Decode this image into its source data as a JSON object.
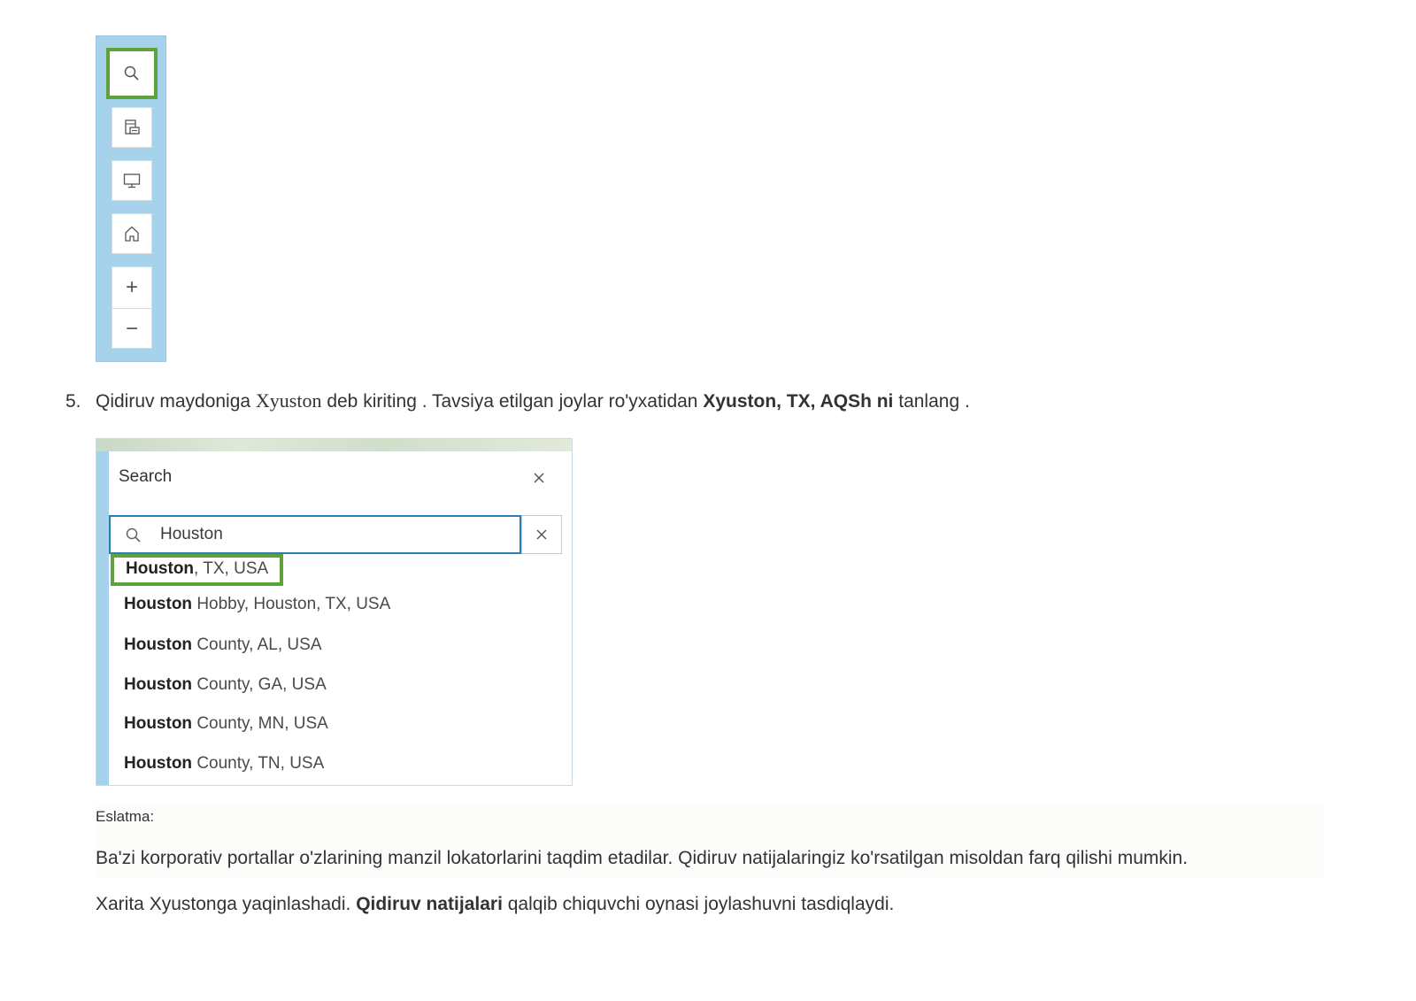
{
  "toolbar": {
    "buttons": [
      {
        "icon": "search-icon"
      },
      {
        "icon": "print-icon"
      },
      {
        "icon": "monitor-icon"
      },
      {
        "icon": "home-icon"
      }
    ],
    "zoom_in": "+",
    "zoom_out": "−"
  },
  "step": {
    "number": "5.",
    "text_before": "Qidiruv maydoniga ",
    "code": "Xyuston",
    "text_middle": " deb kiriting . Tavsiya etilgan joylar ro'yxatidan ",
    "bold": "Xyuston, TX, AQSh ni",
    "text_after": " tanlang ."
  },
  "search_panel": {
    "title": "Search",
    "input_value": "Houston",
    "suggestions": [
      {
        "bold": "Houston",
        "rest": ", TX, USA"
      },
      {
        "bold": "Houston",
        "rest": " Hobby, Houston, TX, USA"
      },
      {
        "bold": "Houston",
        "rest": " County, AL, USA"
      },
      {
        "bold": "Houston",
        "rest": " County, GA, USA"
      },
      {
        "bold": "Houston",
        "rest": " County, MN, USA"
      },
      {
        "bold": "Houston",
        "rest": " County, TN, USA"
      }
    ]
  },
  "note": {
    "label": "Eslatma:",
    "text": "Ba'zi korporativ portallar o'zlarining manzil lokatorlarini taqdim etadilar. Qidiruv natijalaringiz ko'rsatilgan misoldan farq qilishi mumkin."
  },
  "final": {
    "text_before": "Xarita Xyustonga yaqinlashadi. ",
    "bold": "Qidiruv natijalari",
    "text_after": " qalqib chiquvchi oynasi joylashuvni tasdiqlaydi."
  },
  "colors": {
    "highlight": "#5da33a",
    "map_blue": "#a7d2ec",
    "input_border": "#2b7eb3"
  }
}
